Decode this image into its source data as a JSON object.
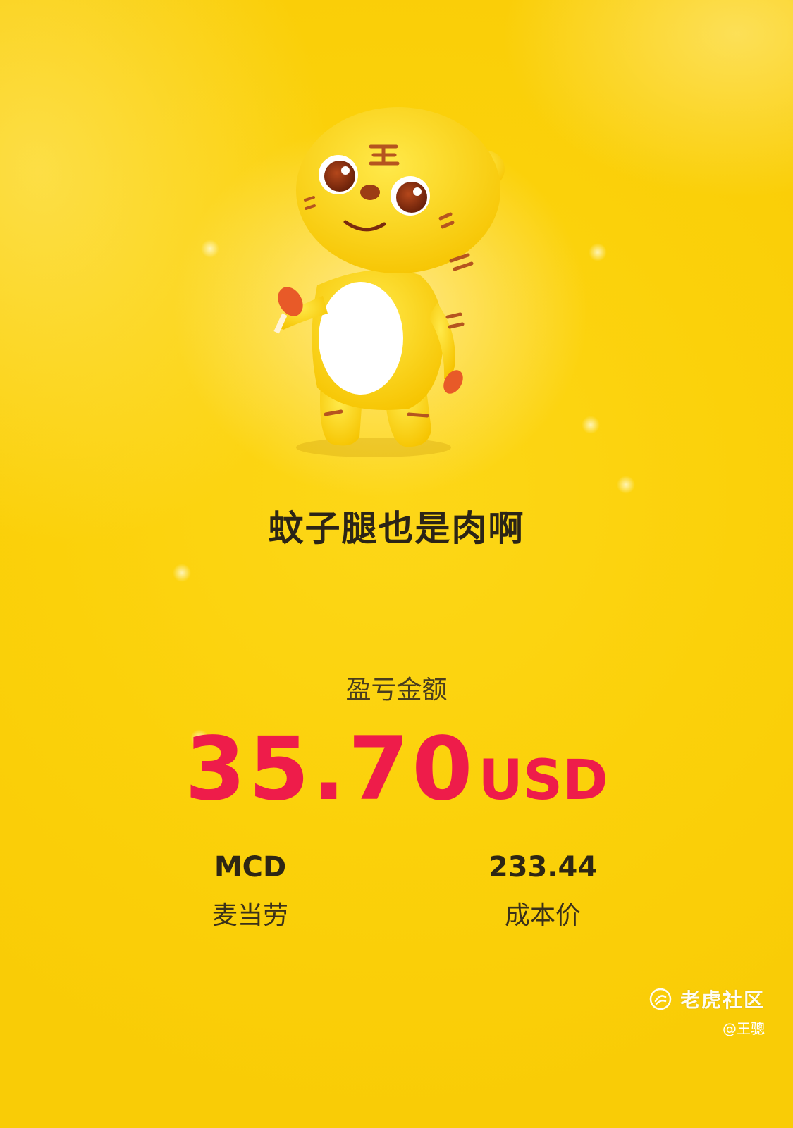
{
  "slogan": "蚊子腿也是肉啊",
  "pnl": {
    "label": "盈亏金额",
    "amount": "35.70",
    "currency": "USD",
    "color": "#ee1c4a"
  },
  "stock": {
    "ticker": "MCD",
    "name": "麦当劳"
  },
  "cost": {
    "value": "233.44",
    "label": "成本价"
  },
  "watermark": {
    "brand": "老虎社区",
    "user": "@王骢"
  },
  "colors": {
    "background": "#fbd10a",
    "text_dark": "#2b2417",
    "accent": "#ee1c4a"
  }
}
